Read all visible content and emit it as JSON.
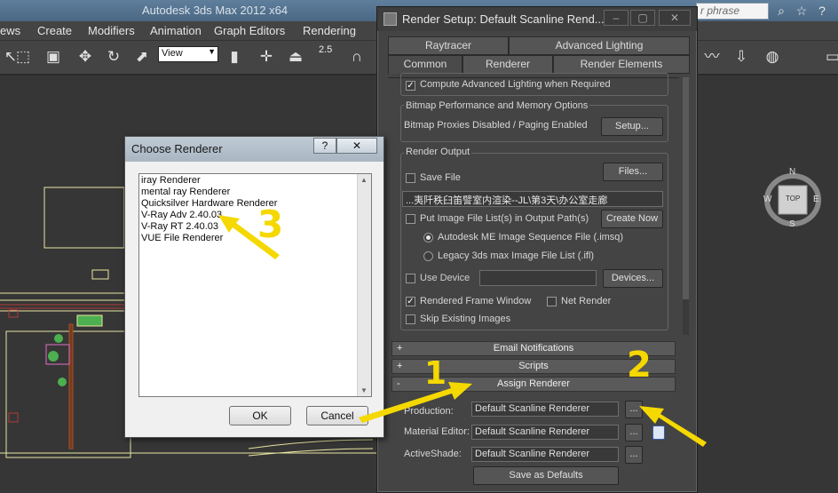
{
  "app": {
    "title": "Autodesk 3ds Max 2012 x64",
    "search_placeholder": "r phrase"
  },
  "menubar": [
    "ews",
    "Create",
    "Modifiers",
    "Animation",
    "Graph Editors",
    "Rendering"
  ],
  "toolbar": {
    "view_select": "View",
    "snap_value": "2.5"
  },
  "viewcube": {
    "label": "TOP",
    "compass": {
      "n": "N",
      "e": "E",
      "w": "W",
      "s": "S"
    }
  },
  "render_setup": {
    "title": "Render Setup: Default Scanline Rend...",
    "tabs_top": [
      "Raytracer",
      "Advanced Lighting"
    ],
    "tabs_bottom": [
      "Common",
      "Renderer",
      "Render Elements"
    ],
    "active_tab": "Common",
    "compute_adv_lighting": "Compute Advanced Lighting when Required",
    "bitmap": {
      "group_label": "Bitmap Performance and Memory Options",
      "status": "Bitmap Proxies Disabled / Paging Enabled",
      "setup_button": "Setup..."
    },
    "render_output": {
      "group_label": "Render Output",
      "save_file": "Save File",
      "files_button": "Files...",
      "path": "...夷阡秩臼笛譬室内渲染--JL\\第3天\\办公室走廊",
      "put_image_file_list": "Put Image File List(s) in Output Path(s)",
      "create_now_button": "Create Now",
      "option_imsq": "Autodesk ME Image Sequence File (.imsq)",
      "option_ifl": "Legacy 3ds max Image File List (.ifl)",
      "use_device": "Use Device",
      "devices_button": "Devices...",
      "rendered_frame_window": "Rendered Frame Window",
      "net_render": "Net Render",
      "skip_existing": "Skip Existing Images"
    },
    "rollups": {
      "email": "Email Notifications",
      "scripts": "Scripts",
      "assign": "Assign Renderer"
    },
    "assign": {
      "production_label": "Production:",
      "production_value": "Default Scanline Renderer",
      "material_label": "Material Editor:",
      "material_value": "Default Scanline Renderer",
      "activeshade_label": "ActiveShade:",
      "activeshade_value": "Default Scanline Renderer",
      "browse": "...",
      "save_defaults": "Save as Defaults"
    }
  },
  "chooser": {
    "title": "Choose Renderer",
    "help": "?",
    "close": "✕",
    "items": [
      "iray Renderer",
      "mental ray Renderer",
      "Quicksilver Hardware Renderer",
      "V-Ray Adv 2.40.03",
      "V-Ray RT 2.40.03",
      "VUE File Renderer"
    ],
    "ok": "OK",
    "cancel": "Cancel"
  },
  "annotations": {
    "one": "1",
    "two": "2",
    "three": "3"
  },
  "colors": {
    "annotation": "#f5d800",
    "bg": "#2b2b2b",
    "panel": "#444444"
  }
}
